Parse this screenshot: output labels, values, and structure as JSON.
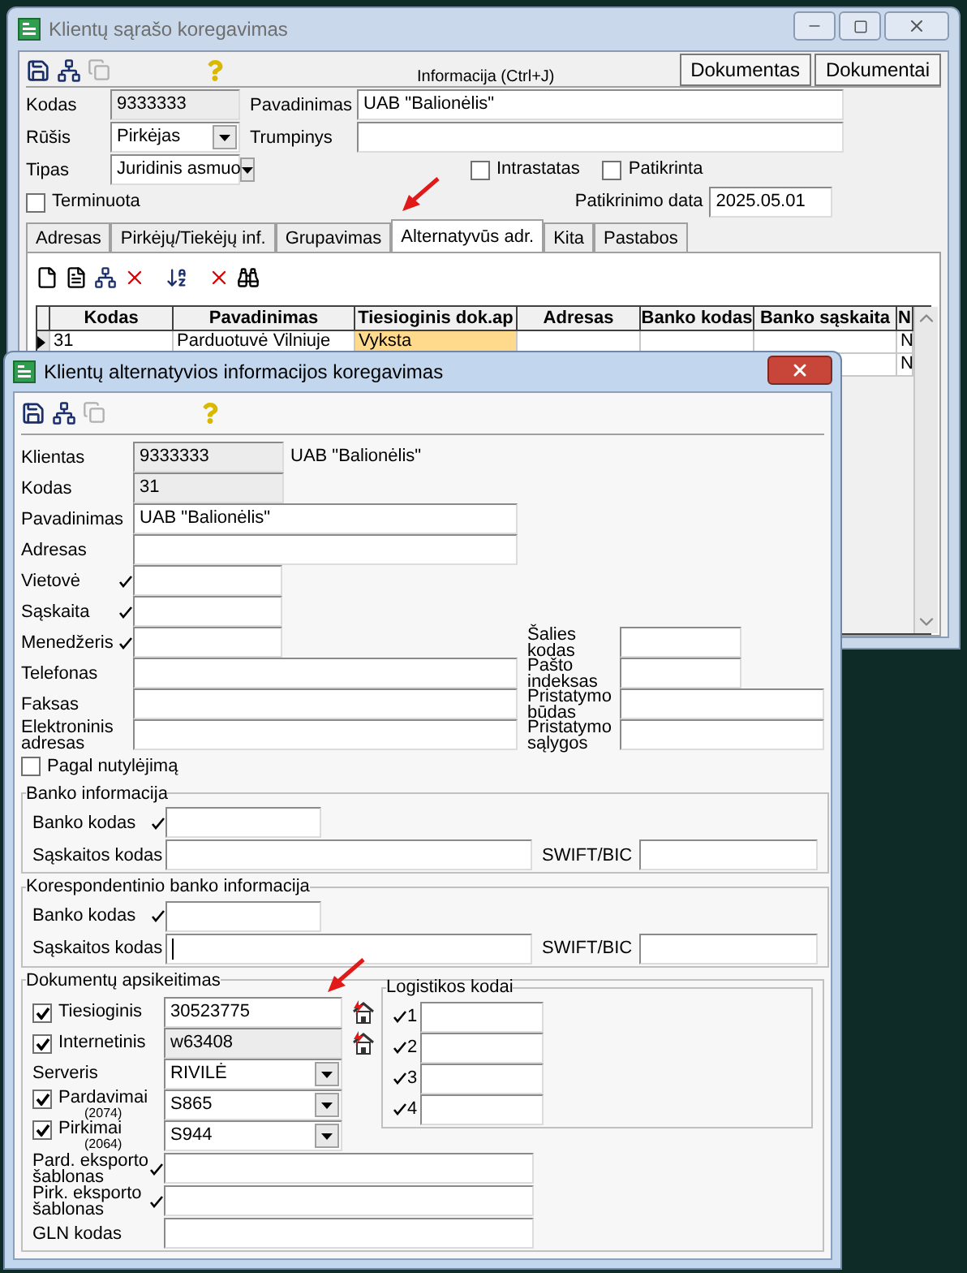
{
  "main_window": {
    "title": "Klientų sąrašo koregavimas",
    "info_label": "Informacija (Ctrl+J)",
    "buttons": [
      "Dokumentas",
      "Dokumentai"
    ],
    "kodas": {
      "label": "Kodas",
      "value": "9333333"
    },
    "pavadinimas": {
      "label": "Pavadinimas",
      "value": "UAB \"Balionėlis\""
    },
    "rusis": {
      "label": "Rūšis",
      "value": "Pirkėjas"
    },
    "trumpinys": {
      "label": "Trumpinys"
    },
    "tipas": {
      "label": "Tipas",
      "value": "Juridinis asmuo"
    },
    "checkboxes": [
      {
        "label": "Intrastatas",
        "checked": false
      },
      {
        "label": "Patikrinta",
        "checked": false
      },
      {
        "label": "Terminuota",
        "checked": false
      }
    ],
    "patikrinimo_data": {
      "label": "Patikrinimo data",
      "value": "2025.05.01"
    },
    "tabs": [
      {
        "label": "Adresas",
        "selected": false
      },
      {
        "label": "Pirkėjų/Tiekėjų inf.",
        "selected": false
      },
      {
        "label": "Grupavimas",
        "selected": false
      },
      {
        "label": "Alternatyvūs adr.",
        "selected": true
      },
      {
        "label": "Kita",
        "selected": false
      },
      {
        "label": "Pastabos",
        "selected": false
      }
    ],
    "table": {
      "columns": [
        "Kodas",
        "Pavadinimas",
        "Tiesioginis dok.ap",
        "Adresas",
        "Banko kodas",
        "Banko sąskaita",
        "N"
      ],
      "rows": [
        {
          "selected": true,
          "cells": [
            {
              "text": "31",
              "highlighted": false
            },
            {
              "text": "Parduotuvė Vilniuje",
              "highlighted": false
            },
            {
              "text": "Vyksta",
              "highlighted": true
            },
            null,
            null,
            null,
            {
              "text": "N",
              "highlighted": false
            }
          ]
        },
        {
          "cells": [
            null,
            null,
            null,
            null,
            null,
            null,
            {
              "text": "N",
              "highlighted": false
            }
          ]
        }
      ]
    }
  },
  "dialog": {
    "title": "Klientų alternatyvios informacijos koregavimas",
    "klientas": {
      "label": "Klientas",
      "value": "9333333",
      "name": "UAB \"Balionėlis\""
    },
    "left_fields": [
      {
        "label": "Kodas",
        "value": "31",
        "readonly": true,
        "lookup": false
      },
      {
        "label": "Pavadinimas",
        "value": "UAB \"Balionėlis\"",
        "readonly": false,
        "lookup": false
      },
      {
        "label": "Adresas",
        "readonly": false,
        "lookup": false
      },
      {
        "label": "Vietovė",
        "readonly": false,
        "lookup": true
      },
      {
        "label": "Sąskaita",
        "readonly": false,
        "lookup": true
      },
      {
        "label": "Menedžeris",
        "readonly": false,
        "lookup": true
      },
      {
        "label": "Telefonas",
        "readonly": false,
        "lookup": false
      },
      {
        "label": "Faksas",
        "readonly": false,
        "lookup": false
      },
      {
        "label": "Elektroninis adresas",
        "readonly": false,
        "lookup": false
      }
    ],
    "right_fields": [
      {
        "label": "Šalies kodas"
      },
      {
        "label": "Pašto indeksas"
      },
      {
        "label": "Pristatymo būdas"
      },
      {
        "label": "Pristatymo sąlygos"
      }
    ],
    "default_checkbox": {
      "label": "Pagal nutylėjimą",
      "checked": false
    },
    "bank_groups": [
      {
        "title": "Banko informacija",
        "bank_code": {
          "label": "Banko kodas",
          "lookup": true
        },
        "account": {
          "label": "Sąskaitos kodas",
          "focused": false
        },
        "swift": {
          "label": "SWIFT/BIC"
        }
      },
      {
        "title": "Korespondentinio banko informacija",
        "bank_code": {
          "label": "Banko kodas",
          "lookup": true
        },
        "account": {
          "label": "Sąskaitos kodas",
          "focused": true
        },
        "swift": {
          "label": "SWIFT/BIC"
        }
      }
    ],
    "documents": {
      "title": "Dokumentų apsikeitimas",
      "rows": [
        {
          "kind": "check",
          "label": "Tiesioginis",
          "checked": true,
          "value": "30523775",
          "readonly": false
        },
        {
          "kind": "check",
          "label": "Internetinis",
          "checked": true,
          "value": "w63408",
          "readonly": true
        },
        {
          "kind": "select",
          "label": "Serveris",
          "value": "RIVILĖ"
        },
        {
          "kind": "check_select",
          "label": "Pardavimai",
          "note": "(2074)",
          "checked": true,
          "value": "S865"
        },
        {
          "kind": "check_select",
          "label": "Pirkimai",
          "note": "(2064)",
          "checked": true,
          "value": "S944"
        }
      ],
      "templates": [
        {
          "label": "Pard. eksporto šablonas",
          "lookup": true
        },
        {
          "label": "Pirk. eksporto šablonas",
          "lookup": true
        },
        {
          "label": "GLN kodas",
          "lookup": false
        }
      ],
      "logistics": {
        "title": "Logistikos kodai",
        "codes": [
          {
            "label": "1",
            "lookup": true
          },
          {
            "label": "2",
            "lookup": true
          },
          {
            "label": "3",
            "lookup": true
          },
          {
            "label": "4",
            "lookup": true
          }
        ]
      }
    }
  }
}
